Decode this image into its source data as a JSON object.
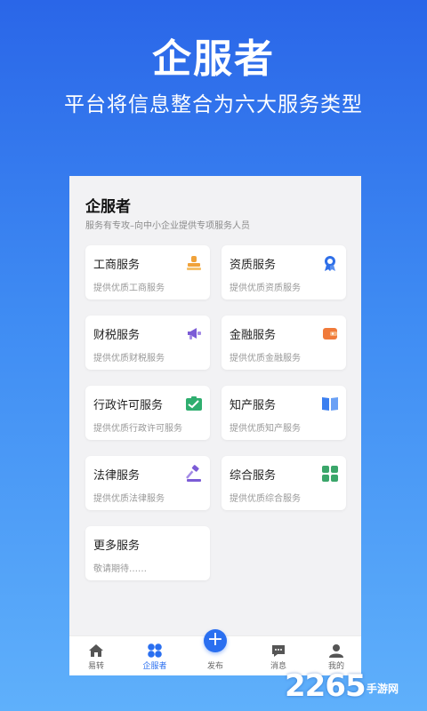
{
  "hero": {
    "title": "企服者",
    "subtitle": "平台将信息整合为六大服务类型"
  },
  "app": {
    "brand": "企服者",
    "brand_sub": "服务有专攻–向中小企业提供专项服务人员"
  },
  "services": [
    {
      "title": "工商服务",
      "desc": "提供优质工商服务",
      "icon": "stamp-icon",
      "color": "#f0a23a"
    },
    {
      "title": "资质服务",
      "desc": "提供优质资质服务",
      "icon": "badge-icon",
      "color": "#2f6fe8"
    },
    {
      "title": "财税服务",
      "desc": "提供优质财税服务",
      "icon": "megaphone-icon",
      "color": "#7b5bd6"
    },
    {
      "title": "金融服务",
      "desc": "提供优质金融服务",
      "icon": "wallet-icon",
      "color": "#f07a3a"
    },
    {
      "title": "行政许可服务",
      "desc": "提供优质行政许可服务",
      "icon": "license-icon",
      "color": "#2fae6f"
    },
    {
      "title": "知产服务",
      "desc": "提供优质知产服务",
      "icon": "book-icon",
      "color": "#3b7ff0"
    },
    {
      "title": "法律服务",
      "desc": "提供优质法律服务",
      "icon": "gavel-icon",
      "color": "#7b5bd6"
    },
    {
      "title": "综合服务",
      "desc": "提供优质综合服务",
      "icon": "grid-icon",
      "color": "#3aa66a"
    },
    {
      "title": "更多服务",
      "desc": "敬请期待……",
      "icon": "",
      "color": ""
    }
  ],
  "tabbar": {
    "items": [
      {
        "label": "易转",
        "icon": "home-icon"
      },
      {
        "label": "企服者",
        "icon": "clover-icon"
      },
      {
        "label": "发布",
        "icon": "plus-icon"
      },
      {
        "label": "消息",
        "icon": "chat-icon"
      },
      {
        "label": "我的",
        "icon": "user-icon"
      }
    ],
    "active_color": "#2a6ff0"
  },
  "watermark": {
    "number": "2265",
    "text": "手游网"
  }
}
